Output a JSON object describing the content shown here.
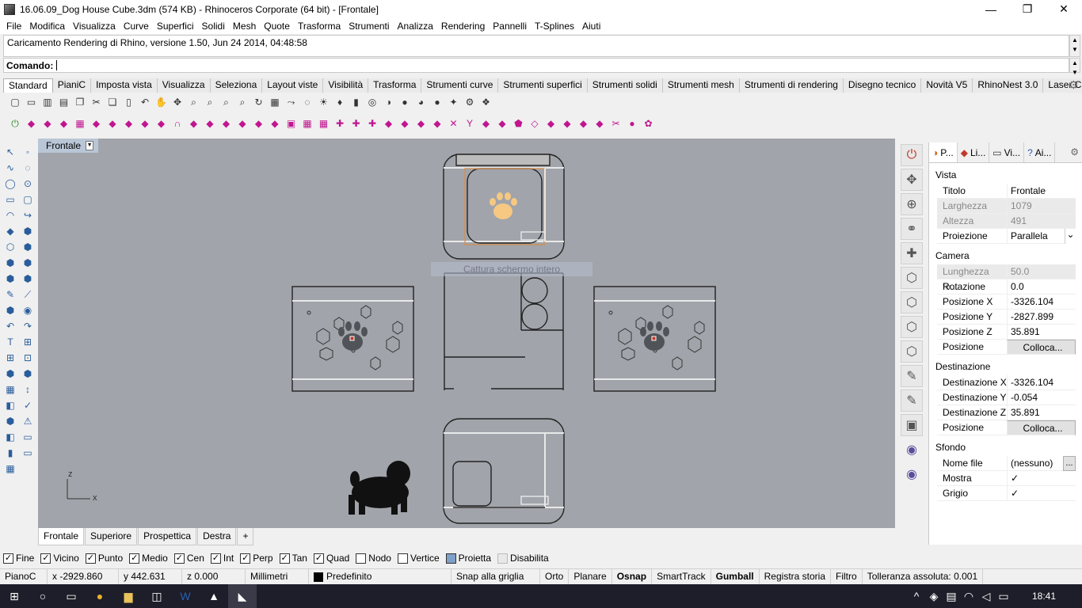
{
  "window": {
    "title": "16.06.09_Dog House Cube.3dm (574 KB) - Rhinoceros Corporate (64 bit) - [Frontale]",
    "minimize": "—",
    "restore": "❐",
    "close": "✕"
  },
  "menu": [
    "File",
    "Modifica",
    "Visualizza",
    "Curve",
    "Superfici",
    "Solidi",
    "Mesh",
    "Quote",
    "Trasforma",
    "Strumenti",
    "Analizza",
    "Rendering",
    "Pannelli",
    "T-Splines",
    "Aiuti"
  ],
  "history": "Caricamento Rendering di Rhino, versione 1.50, Jun 24 2014, 04:48:58",
  "command": {
    "label": "Comando:"
  },
  "toolbar_tabs": [
    "Standard",
    "PianiC",
    "Imposta vista",
    "Visualizza",
    "Seleziona",
    "Layout viste",
    "Visibilità",
    "Trasforma",
    "Strumenti curve",
    "Strumenti superfici",
    "Strumenti solidi",
    "Strumenti mesh",
    "Strumenti di rendering",
    "Disegno tecnico",
    "Novità V5",
    "RhinoNest 3.0",
    "Laser Cut"
  ],
  "viewport": {
    "title": "Frontale",
    "axis_z": "z",
    "axis_x": "x",
    "tooltip": "Cattura schermo intero"
  },
  "view_tabs": [
    "Frontale",
    "Superiore",
    "Prospettica",
    "Destra",
    "+"
  ],
  "osnaps": [
    {
      "label": "Fine",
      "checked": true
    },
    {
      "label": "Vicino",
      "checked": true
    },
    {
      "label": "Punto",
      "checked": true
    },
    {
      "label": "Medio",
      "checked": true
    },
    {
      "label": "Cen",
      "checked": true
    },
    {
      "label": "Int",
      "checked": true
    },
    {
      "label": "Perp",
      "checked": true
    },
    {
      "label": "Tan",
      "checked": true
    },
    {
      "label": "Quad",
      "checked": true
    },
    {
      "label": "Nodo",
      "checked": false
    },
    {
      "label": "Vertice",
      "checked": false
    },
    {
      "label": "Proietta",
      "checked": false
    },
    {
      "label": "Disabilita",
      "checked": false
    }
  ],
  "status": {
    "plane": "PianoC",
    "x": "x -2929.860",
    "y": "y 442.631",
    "z": "z 0.000",
    "units": "Millimetri",
    "layer": "Predefinito",
    "snap": "Snap alla griglia",
    "orto": "Orto",
    "planare": "Planare",
    "osnap": "Osnap",
    "smarttrack": "SmartTrack",
    "gumball": "Gumball",
    "history": "Registra storia",
    "filter": "Filtro",
    "tolerance": "Tolleranza assoluta: 0.001"
  },
  "panel": {
    "tabs": [
      "P...",
      "Li...",
      "Vi...",
      "Ai..."
    ],
    "sections": {
      "vista": "Vista",
      "camera": "Camera",
      "destinazione": "Destinazione",
      "sfondo": "Sfondo"
    },
    "vista": [
      {
        "k": "Titolo",
        "v": "Frontale"
      },
      {
        "k": "Larghezza",
        "v": "1079",
        "disabled": true
      },
      {
        "k": "Altezza",
        "v": "491",
        "disabled": true
      },
      {
        "k": "Proiezione",
        "v": "Parallela"
      }
    ],
    "camera": [
      {
        "k": "Lunghezza fo...",
        "v": "50.0",
        "disabled": true
      },
      {
        "k": "Rotazione",
        "v": "0.0"
      },
      {
        "k": "Posizione X",
        "v": "-3326.104"
      },
      {
        "k": "Posizione Y",
        "v": "-2827.899"
      },
      {
        "k": "Posizione Z",
        "v": "35.891"
      },
      {
        "k": "Posizione",
        "v": "Colloca..."
      }
    ],
    "destinazione": [
      {
        "k": "Destinazione X",
        "v": "-3326.104"
      },
      {
        "k": "Destinazione Y",
        "v": "-0.054"
      },
      {
        "k": "Destinazione Z",
        "v": "35.891"
      },
      {
        "k": "Posizione",
        "v": "Colloca..."
      }
    ],
    "sfondo": [
      {
        "k": "Nome file",
        "v": "(nessuno)",
        "extra": "..."
      },
      {
        "k": "Mostra",
        "v": "✓"
      },
      {
        "k": "Grigio",
        "v": "✓"
      }
    ]
  },
  "taskbar": {
    "time": "18:41"
  }
}
